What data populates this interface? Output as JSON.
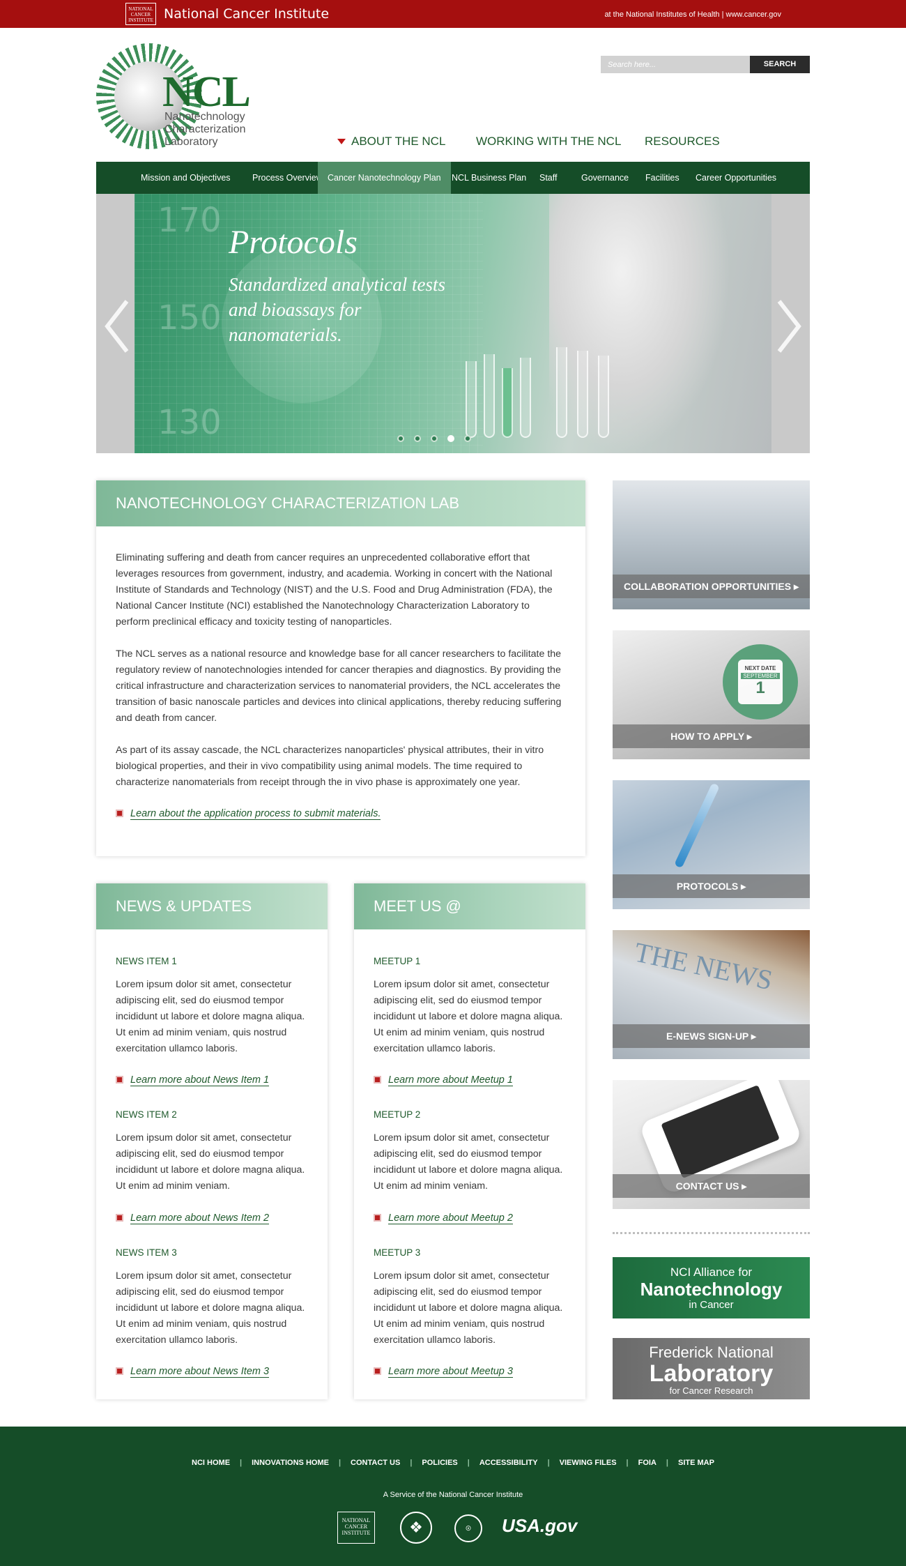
{
  "topbar": {
    "logo_text": "NATIONAL CANCER INSTITUTE",
    "title": "National Cancer Institute",
    "nih_text": "at the National Institutes of Health  |  www.cancer.gov"
  },
  "logo": {
    "letters": "NCL",
    "line1": "Nanotechnology",
    "line2": "Characterization",
    "line3": "Laboratory"
  },
  "search": {
    "placeholder": "Search here...",
    "button": "SEARCH"
  },
  "main_nav": [
    {
      "label": "ABOUT THE NCL",
      "active": true
    },
    {
      "label": "WORKING WITH THE NCL"
    },
    {
      "label": "RESOURCES"
    }
  ],
  "sub_nav": [
    {
      "label": "Mission and Objectives"
    },
    {
      "label": "Process Overview"
    },
    {
      "label": "Cancer Nanotechnology Plan",
      "active": true
    },
    {
      "label": "NCL Business Plan"
    },
    {
      "label": "Staff"
    },
    {
      "label": "Governance"
    },
    {
      "label": "Facilities"
    },
    {
      "label": "Career Opportunities"
    }
  ],
  "hero": {
    "title": "Protocols",
    "subtitle": "Standardized analytical tests and bioassays for nanomaterials.",
    "bg_numbers": [
      "170",
      "150",
      "130"
    ],
    "slide_count": 5,
    "active_slide": 4
  },
  "about": {
    "heading": "NANOTECHNOLOGY CHARACTERIZATION LAB",
    "p1": "Eliminating suffering and death from cancer requires an unprecedented collaborative effort that leverages resources from government, industry, and academia. Working in concert with the National Institute of Standards and Technology (NIST) and the U.S. Food and Drug Administration (FDA), the National Cancer Institute (NCI) established the Nanotechnology Characterization Laboratory to perform preclinical efficacy and toxicity testing of nanoparticles.",
    "p2": "The NCL serves as a national resource and knowledge base for all cancer researchers to facilitate the regulatory review of nanotechnologies intended for cancer therapies and diagnostics. By providing the critical infrastructure and characterization services to nanomaterial providers, the NCL accelerates the transition of basic nanoscale particles and devices into clinical applications, thereby reducing suffering and death from cancer.",
    "p3": "As part of its assay cascade, the NCL characterizes nanoparticles' physical attributes, their in vitro biological properties, and their in vivo compatibility using animal models. The time required to characterize nanomaterials from receipt through the in vivo phase is approximately one year.",
    "link": "Learn about the application process to submit materials."
  },
  "news": {
    "heading": "NEWS & UPDATES",
    "items": [
      {
        "title": "NEWS ITEM 1",
        "body": "Lorem ipsum dolor sit amet, consectetur adipiscing elit, sed do eiusmod tempor incididunt ut labore et dolore magna aliqua. Ut enim ad minim veniam, quis nostrud exercitation ullamco laboris.",
        "link": "Learn more about News Item 1"
      },
      {
        "title": "NEWS ITEM 2",
        "body": "Lorem ipsum dolor sit amet, consectetur adipiscing elit, sed do eiusmod tempor incididunt ut labore et dolore magna aliqua. Ut enim ad minim veniam.",
        "link": "Learn more about News Item 2"
      },
      {
        "title": "NEWS ITEM 3",
        "body": "Lorem ipsum dolor sit amet, consectetur adipiscing elit, sed do eiusmod tempor incididunt ut labore et dolore magna aliqua. Ut enim ad minim veniam, quis nostrud exercitation ullamco laboris.",
        "link": "Learn more about News Item 3"
      }
    ]
  },
  "meet": {
    "heading": "MEET US @",
    "items": [
      {
        "title": "MEETUP 1",
        "body": "Lorem ipsum dolor sit amet, consectetur adipiscing elit, sed do eiusmod tempor incididunt ut labore et dolore magna aliqua. Ut enim ad minim veniam, quis nostrud exercitation ullamco laboris.",
        "link": "Learn more about Meetup 1"
      },
      {
        "title": "MEETUP 2",
        "body": "Lorem ipsum dolor sit amet, consectetur adipiscing elit, sed do eiusmod tempor incididunt ut labore et dolore magna aliqua. Ut enim ad minim veniam.",
        "link": "Learn more about Meetup 2"
      },
      {
        "title": "MEETUP 3",
        "body": "Lorem ipsum dolor sit amet, consectetur adipiscing elit, sed do eiusmod tempor incididunt ut labore et dolore magna aliqua. Ut enim ad minim veniam, quis nostrud exercitation ullamco laboris.",
        "link": "Learn more about Meetup 3"
      }
    ]
  },
  "tiles": [
    {
      "label": "COLLABORATION OPPORTUNITIES ▸"
    },
    {
      "label": "HOW TO APPLY ▸",
      "calendar": {
        "next": "NEXT DATE",
        "month": "SEPTEMBER",
        "day": "1"
      }
    },
    {
      "label": "PROTOCOLS ▸"
    },
    {
      "label": "E-NEWS SIGN-UP ▸",
      "image_text": "THE NEWS"
    },
    {
      "label": "CONTACT US ▸"
    }
  ],
  "banners": {
    "alliance": {
      "l1": "NCI Alliance for",
      "l2": "Nanotechnology",
      "l3": "in Cancer"
    },
    "frederick": {
      "l1": "Frederick National",
      "l2": "Laboratory",
      "l3": "for Cancer Research"
    }
  },
  "footer": {
    "links": [
      "NCI HOME",
      "INNOVATIONS HOME",
      "CONTACT US",
      "POLICIES",
      "ACCESSIBILITY",
      "VIEWING FILES",
      "FOIA",
      "SITE MAP"
    ],
    "service": "A Service of the National Cancer Institute",
    "logo_nci": "NATIONAL CANCER INSTITUTE",
    "logo_usa": "USA.gov"
  },
  "colors": {
    "nci_red": "#a50f0f",
    "nav_green": "#154d28",
    "text_green": "#1f5a2c",
    "card_head_green": "#7fb898",
    "bullet_red": "#b81f1f"
  }
}
